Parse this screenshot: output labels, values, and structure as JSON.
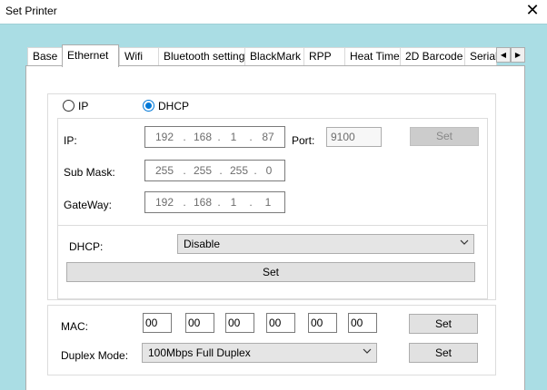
{
  "window": {
    "title": "Set Printer",
    "close_glyph": "✕"
  },
  "tabs": [
    {
      "label": "Base",
      "active": false
    },
    {
      "label": "Ethernet",
      "active": true
    },
    {
      "label": "Wifi",
      "active": false
    },
    {
      "label": "Bluetooth setting",
      "active": false
    },
    {
      "label": "BlackMark",
      "active": false
    },
    {
      "label": "RPP",
      "active": false
    },
    {
      "label": "Heat Time",
      "active": false
    },
    {
      "label": "2D Barcode",
      "active": false
    },
    {
      "label": "Serial",
      "active": false
    }
  ],
  "tab_scroll": {
    "left": "◀",
    "right": "▶"
  },
  "mode": {
    "ip_label": "IP",
    "dhcp_label": "DHCP",
    "selected": "DHCP"
  },
  "network": {
    "ip_label": "IP:",
    "ip": [
      "192",
      "168",
      "1",
      "87"
    ],
    "port_label": "Port:",
    "port": "9100",
    "set_label": "Set",
    "submask_label": "Sub Mask:",
    "submask": [
      "255",
      "255",
      "255",
      "0"
    ],
    "gateway_label": "GateWay:",
    "gateway": [
      "192",
      "168",
      "1",
      "1"
    ],
    "separator": "."
  },
  "dhcp": {
    "label": "DHCP:",
    "value": "Disable",
    "set_label": "Set"
  },
  "mac": {
    "label": "MAC:",
    "octets": [
      "00",
      "00",
      "00",
      "00",
      "00",
      "00"
    ],
    "set_label": "Set"
  },
  "duplex": {
    "label": "Duplex Mode:",
    "value": "100Mbps Full Duplex",
    "set_label": "Set"
  }
}
